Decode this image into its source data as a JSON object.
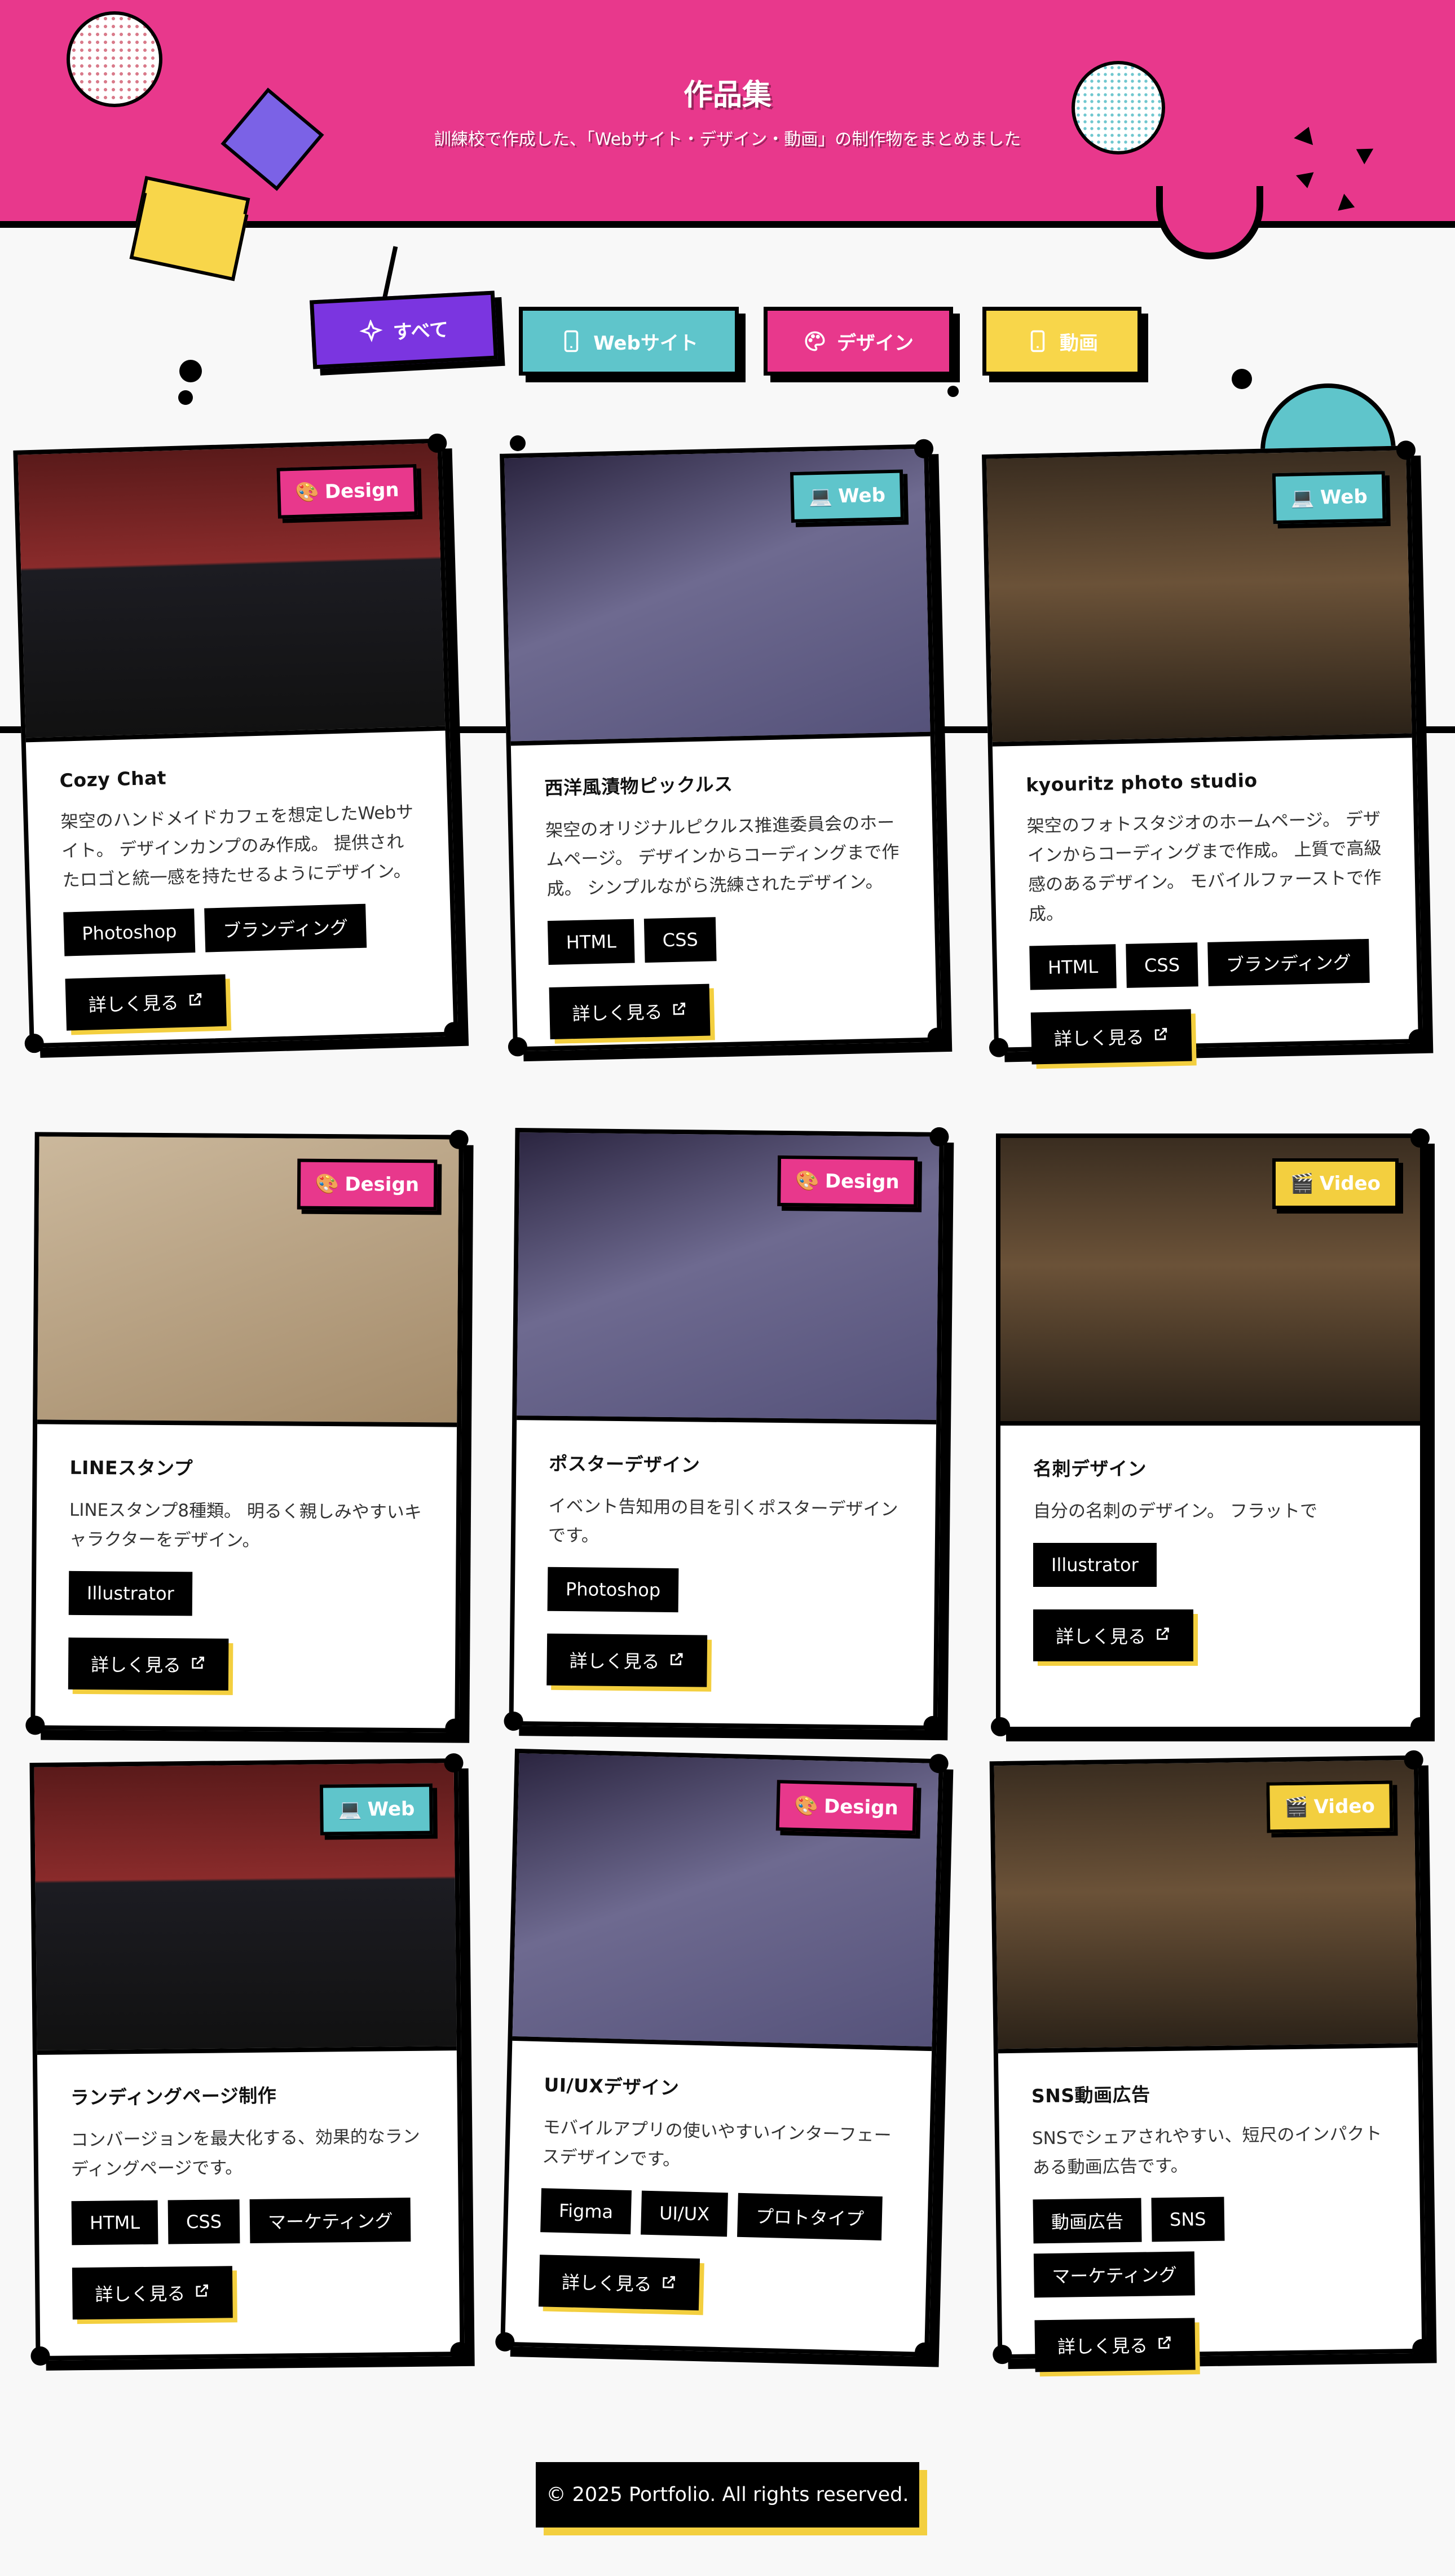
{
  "header": {
    "title": "作品集",
    "subtitle": "訓練校で作成した、「Webサイト・デザイン・動画」の制作物をまとめました"
  },
  "filters": [
    {
      "label": "すべて",
      "icon": "sparkle-icon",
      "color": "#7b35e0",
      "text_color": "#ffffff"
    },
    {
      "label": "Webサイト",
      "icon": "tablet-icon",
      "color": "#5fc5cb",
      "text_color": "#ffffff"
    },
    {
      "label": "デザイン",
      "icon": "palette-icon",
      "color": "#e8388c",
      "text_color": "#ffffff"
    },
    {
      "label": "動画",
      "icon": "phone-icon",
      "color": "#f8d64a",
      "text_color": "#ffffff"
    }
  ],
  "badge_colors": {
    "Design": "#e8388c",
    "Web": "#5fc5cb",
    "Video": "#f3cf3f"
  },
  "cards": [
    {
      "category": "Design",
      "badge_icon": "🎨",
      "title": "Cozy Chat",
      "desc": "架空のハンドメイドカフェを想定したWebサイト。 デザインカンプのみ作成。 提供されたロゴと統一感を持たせるようにデザイン。",
      "tags": [
        "Photoshop",
        "ブランディング"
      ],
      "more": "詳しく見る"
    },
    {
      "category": "Web",
      "badge_icon": "💻",
      "title": "西洋風漬物ピックルス",
      "desc": "架空のオリジナルピクルス推進委員会のホームページ。 デザインからコーディングまで作成。 シンプルながら洗練されたデザイン。",
      "tags": [
        "HTML",
        "CSS"
      ],
      "more": "詳しく見る"
    },
    {
      "category": "Web",
      "badge_icon": "💻",
      "title": "kyouritz photo studio",
      "desc": "架空のフォトスタジオのホームページ。 デザインからコーディングまで作成。 上質で高級感のあるデザイン。 モバイルファーストで作成。",
      "tags": [
        "HTML",
        "CSS",
        "ブランディング"
      ],
      "more": "詳しく見る"
    },
    {
      "category": "Design",
      "badge_icon": "🎨",
      "title": "LINEスタンプ",
      "desc": "LINEスタンプ8種類。 明るく親しみやすいキャラクターをデザイン。",
      "tags": [
        "Illustrator"
      ],
      "more": "詳しく見る"
    },
    {
      "category": "Design",
      "badge_icon": "🎨",
      "title": "ポスターデザイン",
      "desc": "イベント告知用の目を引くポスターデザインです。",
      "tags": [
        "Photoshop"
      ],
      "more": "詳しく見る"
    },
    {
      "category": "Video",
      "badge_icon": "🎬",
      "title": "名刺デザイン",
      "desc": "自分の名刺のデザイン。 フラットで",
      "tags": [
        "Illustrator"
      ],
      "more": "詳しく見る"
    },
    {
      "category": "Web",
      "badge_icon": "💻",
      "title": "ランディングページ制作",
      "desc": "コンバージョンを最大化する、効果的なランディングページです。",
      "tags": [
        "HTML",
        "CSS",
        "マーケティング"
      ],
      "more": "詳しく見る"
    },
    {
      "category": "Design",
      "badge_icon": "🎨",
      "title": "UI/UXデザイン",
      "desc": "モバイルアプリの使いやすいインターフェースデザインです。",
      "tags": [
        "Figma",
        "UI/UX",
        "プロトタイプ"
      ],
      "more": "詳しく見る"
    },
    {
      "category": "Video",
      "badge_icon": "🎬",
      "title": "SNS動画広告",
      "desc": "SNSでシェアされやすい、短尺のインパクトある動画広告です。",
      "tags": [
        "動画広告",
        "SNS",
        "マーケティング"
      ],
      "more": "詳しく見る"
    }
  ],
  "footer": {
    "text": "© 2025 Portfolio. All rights reserved."
  }
}
